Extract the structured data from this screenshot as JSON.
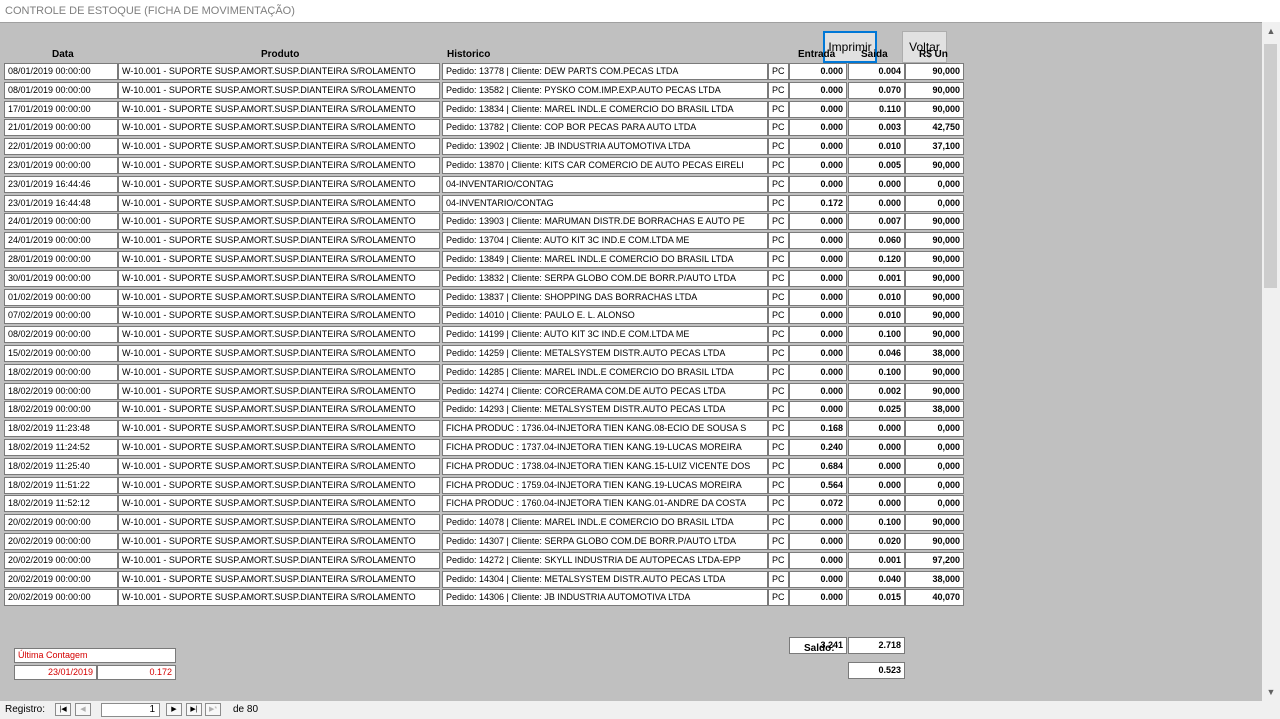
{
  "window": {
    "title": "CONTROLE DE ESTOQUE (FICHA DE MOVIMENTAÇÃO)"
  },
  "toolbar": {
    "print_label": "Imprimir",
    "back_label": "Voltar"
  },
  "columns": {
    "data": "Data",
    "produto": "Produto",
    "historico": "Historico",
    "entrada": "Entrada",
    "saida": "Saida",
    "rs_un": "R$ Un"
  },
  "rows": [
    {
      "date": "08/01/2019 00:00:00",
      "product": "W-10.001 - SUPORTE SUSP.AMORT.SUSP.DIANTEIRA S/ROLAMENTO",
      "history": "Pedido: 13778  |  Cliente: DEW PARTS COM.PECAS LTDA",
      "unit": "PC",
      "entrada": "0.000",
      "saida": "0.004",
      "price": "90,000"
    },
    {
      "date": "08/01/2019 00:00:00",
      "product": "W-10.001 - SUPORTE SUSP.AMORT.SUSP.DIANTEIRA S/ROLAMENTO",
      "history": "Pedido: 13582  |  Cliente: PYSKO COM.IMP.EXP.AUTO PECAS LTDA",
      "unit": "PC",
      "entrada": "0.000",
      "saida": "0.070",
      "price": "90,000"
    },
    {
      "date": "17/01/2019 00:00:00",
      "product": "W-10.001 - SUPORTE SUSP.AMORT.SUSP.DIANTEIRA S/ROLAMENTO",
      "history": "Pedido: 13834  |  Cliente: MAREL INDL.E COMERCIO DO BRASIL LTDA",
      "unit": "PC",
      "entrada": "0.000",
      "saida": "0.110",
      "price": "90,000"
    },
    {
      "date": "21/01/2019 00:00:00",
      "product": "W-10.001 - SUPORTE SUSP.AMORT.SUSP.DIANTEIRA S/ROLAMENTO",
      "history": "Pedido: 13782  |  Cliente: COP BOR PECAS PARA AUTO LTDA",
      "unit": "PC",
      "entrada": "0.000",
      "saida": "0.003",
      "price": "42,750"
    },
    {
      "date": "22/01/2019 00:00:00",
      "product": "W-10.001 - SUPORTE SUSP.AMORT.SUSP.DIANTEIRA S/ROLAMENTO",
      "history": "Pedido: 13902  |  Cliente: JB INDUSTRIA AUTOMOTIVA LTDA",
      "unit": "PC",
      "entrada": "0.000",
      "saida": "0.010",
      "price": "37,100"
    },
    {
      "date": "23/01/2019 00:00:00",
      "product": "W-10.001 - SUPORTE SUSP.AMORT.SUSP.DIANTEIRA S/ROLAMENTO",
      "history": "Pedido: 13870  |  Cliente: KITS CAR COMERCIO DE AUTO PECAS EIRELI",
      "unit": "PC",
      "entrada": "0.000",
      "saida": "0.005",
      "price": "90,000"
    },
    {
      "date": "23/01/2019 16:44:46",
      "product": "W-10.001 - SUPORTE SUSP.AMORT.SUSP.DIANTEIRA S/ROLAMENTO",
      "history": "04-INVENTARIO/CONTAG",
      "unit": "PC",
      "entrada": "0.000",
      "saida": "0.000",
      "price": "0,000"
    },
    {
      "date": "23/01/2019 16:44:48",
      "product": "W-10.001 - SUPORTE SUSP.AMORT.SUSP.DIANTEIRA S/ROLAMENTO",
      "history": "04-INVENTARIO/CONTAG",
      "unit": "PC",
      "entrada": "0.172",
      "saida": "0.000",
      "price": "0,000"
    },
    {
      "date": "24/01/2019 00:00:00",
      "product": "W-10.001 - SUPORTE SUSP.AMORT.SUSP.DIANTEIRA S/ROLAMENTO",
      "history": "Pedido: 13903  |  Cliente: MARUMAN DISTR.DE BORRACHAS E AUTO PE",
      "unit": "PC",
      "entrada": "0.000",
      "saida": "0.007",
      "price": "90,000"
    },
    {
      "date": "24/01/2019 00:00:00",
      "product": "W-10.001 - SUPORTE SUSP.AMORT.SUSP.DIANTEIRA S/ROLAMENTO",
      "history": "Pedido: 13704  |  Cliente: AUTO KIT 3C IND.E COM.LTDA ME",
      "unit": "PC",
      "entrada": "0.000",
      "saida": "0.060",
      "price": "90,000"
    },
    {
      "date": "28/01/2019 00:00:00",
      "product": "W-10.001 - SUPORTE SUSP.AMORT.SUSP.DIANTEIRA S/ROLAMENTO",
      "history": "Pedido: 13849  |  Cliente: MAREL INDL.E COMERCIO DO BRASIL LTDA",
      "unit": "PC",
      "entrada": "0.000",
      "saida": "0.120",
      "price": "90,000"
    },
    {
      "date": "30/01/2019 00:00:00",
      "product": "W-10.001 - SUPORTE SUSP.AMORT.SUSP.DIANTEIRA S/ROLAMENTO",
      "history": "Pedido: 13832  |  Cliente: SERPA GLOBO COM.DE BORR.P/AUTO LTDA",
      "unit": "PC",
      "entrada": "0.000",
      "saida": "0.001",
      "price": "90,000"
    },
    {
      "date": "01/02/2019 00:00:00",
      "product": "W-10.001 - SUPORTE SUSP.AMORT.SUSP.DIANTEIRA S/ROLAMENTO",
      "history": "Pedido: 13837  |  Cliente: SHOPPING DAS BORRACHAS LTDA",
      "unit": "PC",
      "entrada": "0.000",
      "saida": "0.010",
      "price": "90,000"
    },
    {
      "date": "07/02/2019 00:00:00",
      "product": "W-10.001 - SUPORTE SUSP.AMORT.SUSP.DIANTEIRA S/ROLAMENTO",
      "history": "Pedido: 14010  |  Cliente: PAULO E. L. ALONSO",
      "unit": "PC",
      "entrada": "0.000",
      "saida": "0.010",
      "price": "90,000"
    },
    {
      "date": "08/02/2019 00:00:00",
      "product": "W-10.001 - SUPORTE SUSP.AMORT.SUSP.DIANTEIRA S/ROLAMENTO",
      "history": "Pedido: 14199  |  Cliente: AUTO KIT 3C IND.E COM.LTDA ME",
      "unit": "PC",
      "entrada": "0.000",
      "saida": "0.100",
      "price": "90,000"
    },
    {
      "date": "15/02/2019 00:00:00",
      "product": "W-10.001 - SUPORTE SUSP.AMORT.SUSP.DIANTEIRA S/ROLAMENTO",
      "history": "Pedido: 14259  |  Cliente: METALSYSTEM DISTR.AUTO PECAS LTDA",
      "unit": "PC",
      "entrada": "0.000",
      "saida": "0.046",
      "price": "38,000"
    },
    {
      "date": "18/02/2019 00:00:00",
      "product": "W-10.001 - SUPORTE SUSP.AMORT.SUSP.DIANTEIRA S/ROLAMENTO",
      "history": "Pedido: 14285  |  Cliente: MAREL INDL.E COMERCIO DO BRASIL LTDA",
      "unit": "PC",
      "entrada": "0.000",
      "saida": "0.100",
      "price": "90,000"
    },
    {
      "date": "18/02/2019 00:00:00",
      "product": "W-10.001 - SUPORTE SUSP.AMORT.SUSP.DIANTEIRA S/ROLAMENTO",
      "history": "Pedido: 14274  |  Cliente: CORCERAMA COM.DE AUTO PECAS LTDA",
      "unit": "PC",
      "entrada": "0.000",
      "saida": "0.002",
      "price": "90,000"
    },
    {
      "date": "18/02/2019 00:00:00",
      "product": "W-10.001 - SUPORTE SUSP.AMORT.SUSP.DIANTEIRA S/ROLAMENTO",
      "history": "Pedido: 14293  |  Cliente: METALSYSTEM DISTR.AUTO PECAS LTDA",
      "unit": "PC",
      "entrada": "0.000",
      "saida": "0.025",
      "price": "38,000"
    },
    {
      "date": "18/02/2019 11:23:48",
      "product": "W-10.001 - SUPORTE SUSP.AMORT.SUSP.DIANTEIRA S/ROLAMENTO",
      "history": "FICHA PRODUC : 1736.04-INJETORA  TIEN KANG.08-ECIO DE SOUSA S",
      "unit": "PC",
      "entrada": "0.168",
      "saida": "0.000",
      "price": "0,000"
    },
    {
      "date": "18/02/2019 11:24:52",
      "product": "W-10.001 - SUPORTE SUSP.AMORT.SUSP.DIANTEIRA S/ROLAMENTO",
      "history": "FICHA PRODUC : 1737.04-INJETORA  TIEN KANG.19-LUCAS MOREIRA",
      "unit": "PC",
      "entrada": "0.240",
      "saida": "0.000",
      "price": "0,000"
    },
    {
      "date": "18/02/2019 11:25:40",
      "product": "W-10.001 - SUPORTE SUSP.AMORT.SUSP.DIANTEIRA S/ROLAMENTO",
      "history": "FICHA PRODUC : 1738.04-INJETORA  TIEN KANG.15-LUIZ VICENTE DOS",
      "unit": "PC",
      "entrada": "0.684",
      "saida": "0.000",
      "price": "0,000"
    },
    {
      "date": "18/02/2019 11:51:22",
      "product": "W-10.001 - SUPORTE SUSP.AMORT.SUSP.DIANTEIRA S/ROLAMENTO",
      "history": "FICHA PRODUC : 1759.04-INJETORA  TIEN KANG.19-LUCAS MOREIRA",
      "unit": "PC",
      "entrada": "0.564",
      "saida": "0.000",
      "price": "0,000"
    },
    {
      "date": "18/02/2019 11:52:12",
      "product": "W-10.001 - SUPORTE SUSP.AMORT.SUSP.DIANTEIRA S/ROLAMENTO",
      "history": "FICHA PRODUC : 1760.04-INJETORA  TIEN KANG.01-ANDRE DA COSTA",
      "unit": "PC",
      "entrada": "0.072",
      "saida": "0.000",
      "price": "0,000"
    },
    {
      "date": "20/02/2019 00:00:00",
      "product": "W-10.001 - SUPORTE SUSP.AMORT.SUSP.DIANTEIRA S/ROLAMENTO",
      "history": "Pedido: 14078  |  Cliente: MAREL INDL.E COMERCIO DO BRASIL LTDA",
      "unit": "PC",
      "entrada": "0.000",
      "saida": "0.100",
      "price": "90,000"
    },
    {
      "date": "20/02/2019 00:00:00",
      "product": "W-10.001 - SUPORTE SUSP.AMORT.SUSP.DIANTEIRA S/ROLAMENTO",
      "history": "Pedido: 14307  |  Cliente: SERPA GLOBO COM.DE BORR.P/AUTO LTDA",
      "unit": "PC",
      "entrada": "0.000",
      "saida": "0.020",
      "price": "90,000"
    },
    {
      "date": "20/02/2019 00:00:00",
      "product": "W-10.001 - SUPORTE SUSP.AMORT.SUSP.DIANTEIRA S/ROLAMENTO",
      "history": "Pedido: 14272  |  Cliente: SKYLL INDUSTRIA DE AUTOPECAS LTDA-EPP",
      "unit": "PC",
      "entrada": "0.000",
      "saida": "0.001",
      "price": "97,200"
    },
    {
      "date": "20/02/2019 00:00:00",
      "product": "W-10.001 - SUPORTE SUSP.AMORT.SUSP.DIANTEIRA S/ROLAMENTO",
      "history": "Pedido: 14304  |  Cliente: METALSYSTEM DISTR.AUTO PECAS LTDA",
      "unit": "PC",
      "entrada": "0.000",
      "saida": "0.040",
      "price": "38,000"
    },
    {
      "date": "20/02/2019 00:00:00",
      "product": "W-10.001 - SUPORTE SUSP.AMORT.SUSP.DIANTEIRA S/ROLAMENTO",
      "history": "Pedido: 14306  |  Cliente: JB INDUSTRIA AUTOMOTIVA LTDA",
      "unit": "PC",
      "entrada": "0.000",
      "saida": "0.015",
      "price": "40,070"
    }
  ],
  "totals": {
    "entrada": "3.241",
    "saida": "2.718",
    "saldo_label": "Saldo:",
    "saldo": "0.523"
  },
  "ultima_contagem": {
    "label": "Última Contagem",
    "date": "23/01/2019",
    "value": "0.172"
  },
  "navigation": {
    "label": "Registro:",
    "current": "1",
    "of_label": "de",
    "total": "80"
  },
  "icons": {
    "first": "first-record-icon",
    "prev": "prev-record-icon",
    "next": "next-record-icon",
    "last": "last-record-icon",
    "new": "new-record-icon",
    "scroll_up": "scroll-up-arrow-icon",
    "scroll_down": "scroll-down-arrow-icon"
  },
  "colors": {
    "form_bg": "#c0c0c0",
    "focus_border": "#0078d7",
    "highlight_red": "#d40000"
  }
}
